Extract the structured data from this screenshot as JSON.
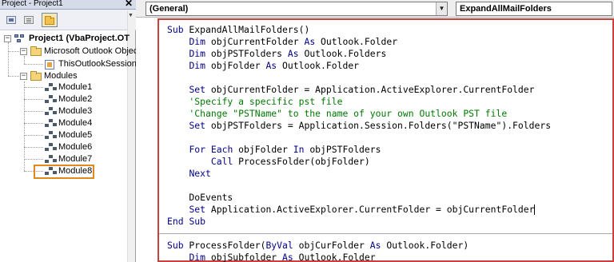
{
  "project_pane": {
    "title": "Project - Project1",
    "close_glyph": "✕",
    "toolbar": {
      "view_code": "view-code-icon",
      "view_object": "view-object-icon",
      "toggle_folders": "toggle-folders-icon"
    },
    "tree": {
      "project": {
        "label": "Project1 (VbaProject.OT",
        "expander": "−"
      },
      "outlook_folder": {
        "label": "Microsoft Outlook Object",
        "expander": "−"
      },
      "session": {
        "label": "ThisOutlookSession"
      },
      "modules_folder": {
        "label": "Modules",
        "expander": "−"
      },
      "modules": [
        "Module1",
        "Module2",
        "Module3",
        "Module4",
        "Module5",
        "Module6",
        "Module7",
        "Module8"
      ],
      "highlighted_module": "Module8"
    }
  },
  "code_window": {
    "object_combo": {
      "value": "(General)"
    },
    "procedure_combo": {
      "value": "ExpandAllMailFolders"
    },
    "lines": [
      "Sub ExpandAllMailFolders()",
      "    Dim objCurrentFolder As Outlook.Folder",
      "    Dim objPSTFolders As Outlook.Folders",
      "    Dim objFolder As Outlook.Folder",
      "",
      "    Set objCurrentFolder = Application.ActiveExplorer.CurrentFolder",
      "    'Specify a specific pst file",
      "    'Change \"PSTName\" to the name of your own Outlook PST file",
      "    Set objPSTFolders = Application.Session.Folders(\"PSTName\").Folders",
      "",
      "    For Each objFolder In objPSTFolders",
      "        Call ProcessFolder(objFolder)",
      "    Next",
      "",
      "    DoEvents",
      "    Set Application.ActiveExplorer.CurrentFolder = objCurrentFolder",
      "End Sub",
      "",
      "Sub ProcessFolder(ByVal objCurFolder As Outlook.Folder)",
      "    Dim objSubfolder As Outlook.Folder"
    ]
  },
  "colors": {
    "keyword": "#00008b",
    "comment": "#007a00",
    "highlight_box": "#e08a1e",
    "code_border": "#c9413b"
  }
}
